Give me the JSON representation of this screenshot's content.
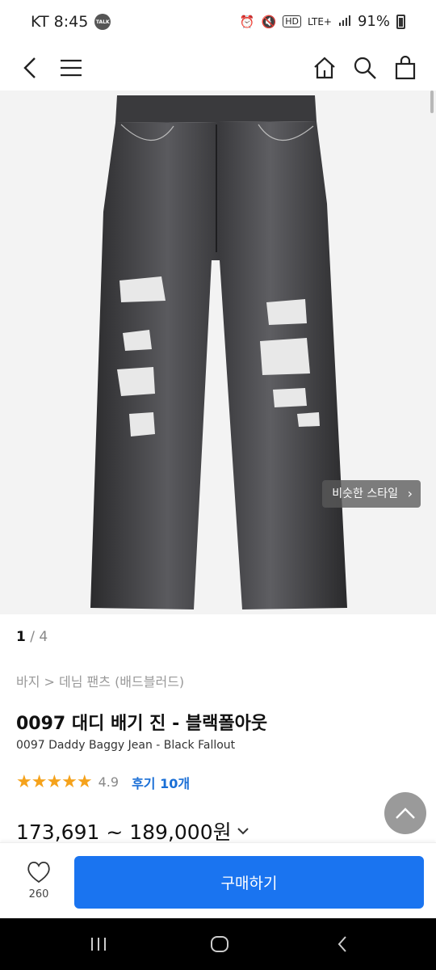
{
  "status_bar": {
    "carrier_time": "KT 8:45",
    "talk_badge": "TALK",
    "network": "LTE+",
    "hd": "HD",
    "battery": "91%"
  },
  "product": {
    "image_alt": "denim jeans",
    "similar_style_label": "비슷한 스타일",
    "pager_current": "1",
    "pager_sep": " / ",
    "pager_total": "4",
    "breadcrumb": "바지 > 데님 팬츠 (배드블러드)",
    "title_ko": "0097 대디 배기 진 - 블랙폴아웃",
    "title_en": "0097 Daddy Baggy Jean - Black Fallout",
    "stars": "★★★★★",
    "rating": "4.9",
    "review_label": "후기 10개",
    "price": "173,691 ~ 189,000원"
  },
  "actions": {
    "like_count": "260",
    "buy_label": "구매하기"
  },
  "colors": {
    "accent": "#1a74f0",
    "star": "#f5a21b",
    "link": "#1a6fd6"
  }
}
